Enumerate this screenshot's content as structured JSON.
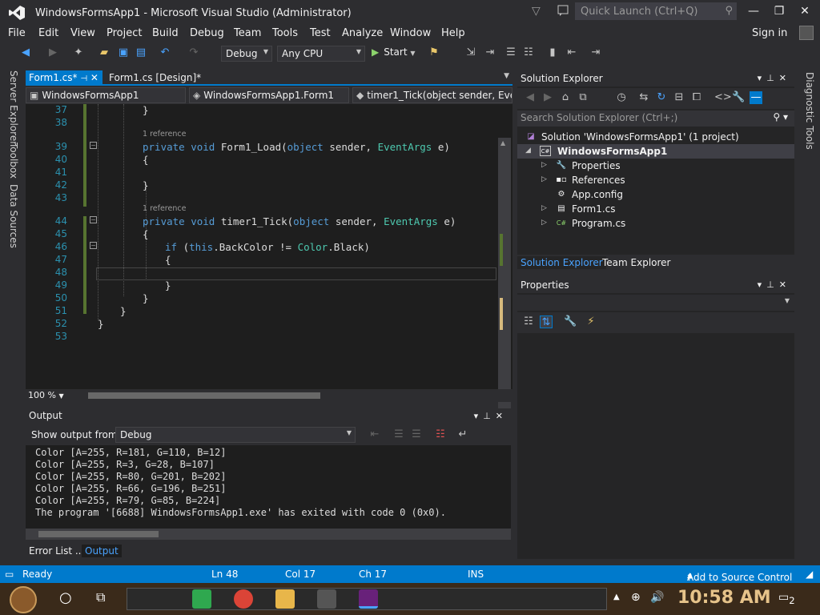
{
  "window": {
    "title": "WindowsFormsApp1 - Microsoft Visual Studio  (Administrator)",
    "quick_launch_placeholder": "Quick Launch (Ctrl+Q)"
  },
  "menu": [
    "File",
    "Edit",
    "View",
    "Project",
    "Build",
    "Debug",
    "Team",
    "Tools",
    "Test",
    "Analyze",
    "Window",
    "Help"
  ],
  "sign_in": "Sign in",
  "toolbar": {
    "config": "Debug",
    "platform": "Any CPU",
    "start": "Start"
  },
  "left_tabs": [
    "Server Explorer",
    "Toolbox",
    "Data Sources"
  ],
  "right_tabs": [
    "Diagnostic Tools"
  ],
  "doc_tabs": [
    {
      "label": "Form1.cs*",
      "active": true
    },
    {
      "label": "Form1.cs [Design]*",
      "active": false
    }
  ],
  "navbar": {
    "project": "WindowsFormsApp1",
    "class": "WindowsFormsApp1.Form1",
    "member": "timer1_Tick(object sender, Ever"
  },
  "code": {
    "lines": [
      {
        "n": "37",
        "text": "}",
        "indent": 1
      },
      {
        "n": "38",
        "text": "",
        "indent": 0
      },
      {
        "n": "39",
        "ref": "1 reference",
        "parts": [
          [
            "kw",
            "private "
          ],
          [
            "kw",
            "void "
          ],
          [
            "",
            "Form1_Load("
          ],
          [
            "kw",
            "object "
          ],
          [
            "",
            "sender, "
          ],
          [
            "ty",
            "EventArgs "
          ],
          [
            "",
            "e)"
          ]
        ]
      },
      {
        "n": "40",
        "text": "{"
      },
      {
        "n": "41",
        "text": ""
      },
      {
        "n": "42",
        "text": "}"
      },
      {
        "n": "43",
        "text": ""
      },
      {
        "n": "44",
        "ref": "1 reference",
        "parts": [
          [
            "kw",
            "private "
          ],
          [
            "kw",
            "void "
          ],
          [
            "",
            "timer1_Tick("
          ],
          [
            "kw",
            "object "
          ],
          [
            "",
            "sender, "
          ],
          [
            "ty",
            "EventArgs "
          ],
          [
            "",
            "e)"
          ]
        ]
      },
      {
        "n": "45",
        "text": "{"
      },
      {
        "n": "46",
        "parts": [
          [
            "kw",
            "if "
          ],
          [
            "",
            "("
          ],
          [
            "kw",
            "this"
          ],
          [
            "",
            ".BackColor != "
          ],
          [
            "ty",
            "Color"
          ],
          [
            "",
            ".Black)"
          ]
        ]
      },
      {
        "n": "47",
        "text": "{"
      },
      {
        "n": "48",
        "text": ""
      },
      {
        "n": "49",
        "text": "}"
      },
      {
        "n": "50",
        "text": "}"
      },
      {
        "n": "51",
        "text": "}"
      },
      {
        "n": "52",
        "text": "}"
      },
      {
        "n": "53",
        "text": ""
      }
    ]
  },
  "zoom": "100 %",
  "output": {
    "title": "Output",
    "show_from_label": "Show output from:",
    "source": "Debug",
    "lines": [
      "Color [A=255, R=181, G=110, B=12]",
      "Color [A=255, R=3, G=28, B=107]",
      "Color [A=255, R=80, G=201, B=202]",
      "Color [A=255, R=66, G=196, B=251]",
      "Color [A=255, R=79, G=85, B=224]",
      "The program '[6688] WindowsFormsApp1.exe' has exited with code 0 (0x0)."
    ]
  },
  "bottom_tabs": [
    "Error List ...",
    "Output"
  ],
  "solution_explorer": {
    "title": "Solution Explorer",
    "search_placeholder": "Search Solution Explorer (Ctrl+;)",
    "tree": [
      {
        "label": "Solution 'WindowsFormsApp1' (1 project)",
        "icon": "solution-icon"
      },
      {
        "label": "WindowsFormsApp1",
        "icon": "csharp-project-icon"
      },
      {
        "label": "Properties",
        "icon": "wrench-icon"
      },
      {
        "label": "References",
        "icon": "references-icon"
      },
      {
        "label": "App.config",
        "icon": "config-file-icon"
      },
      {
        "label": "Form1.cs",
        "icon": "form-icon"
      },
      {
        "label": "Program.cs",
        "icon": "csharp-file-icon"
      }
    ],
    "tabs": [
      "Solution Explorer",
      "Team Explorer"
    ]
  },
  "properties": {
    "title": "Properties"
  },
  "status": {
    "ready": "Ready",
    "ln": "Ln 48",
    "col": "Col 17",
    "ch": "Ch 17",
    "ins": "INS",
    "source_control": "Add to Source Control"
  },
  "taskbar": {
    "time": "10:58 AM",
    "notifications": "2"
  },
  "colors": {
    "accent": "#007acc",
    "editor_bg": "#1e1e1e",
    "keyword": "#569cd6",
    "type": "#4ec9b0",
    "linenum": "#2b91af"
  }
}
